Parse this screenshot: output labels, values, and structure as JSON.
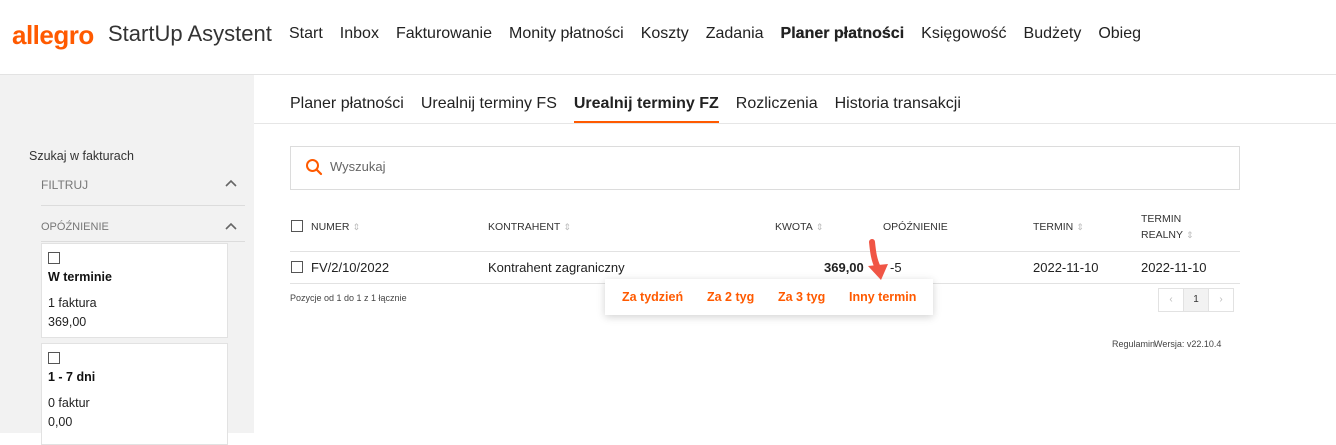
{
  "header": {
    "logo": "allegro",
    "app_name": "StartUp Asystent",
    "nav": [
      "Start",
      "Inbox",
      "Fakturowanie",
      "Monity płatności",
      "Koszty",
      "Zadania",
      "Planer płatności",
      "Księgowość",
      "Budżety",
      "Obieg"
    ],
    "active_nav": "Planer płatności"
  },
  "sidebar": {
    "title": "Szukaj w fakturach",
    "filter_section": "FILTRUJ",
    "delay_section": "OPÓŹNIENIE",
    "cards": [
      {
        "title": "W terminie",
        "count": "1 faktura",
        "amount": "369,00"
      },
      {
        "title": "1 - 7 dni",
        "count": "0 faktur",
        "amount": "0,00"
      }
    ]
  },
  "tabs": [
    "Planer płatności",
    "Urealnij terminy FS",
    "Urealnij terminy FZ",
    "Rozliczenia",
    "Historia transakcji"
  ],
  "active_tab": "Urealnij terminy FZ",
  "search": {
    "placeholder": "Wyszukaj"
  },
  "table": {
    "headers": {
      "numer": "NUMER",
      "kontrahent": "KONTRAHENT",
      "kwota": "KWOTA",
      "opoznienie": "OPÓŹNIENIE",
      "termin": "TERMIN",
      "termin_realny_1": "TERMIN",
      "termin_realny_2": "REALNY"
    },
    "rows": [
      {
        "numer": "FV/2/10/2022",
        "kontrahent": "Kontrahent zagraniczny",
        "kwota": "369,00",
        "opoznienie": "-5",
        "termin": "2022-11-10",
        "termin_realny": "2022-11-10"
      }
    ],
    "position_info": "Pozycje od 1 do 1 z 1 łącznie",
    "pager": {
      "prev": "‹",
      "current": "1",
      "next": "›"
    }
  },
  "popup": {
    "options": [
      "Za tydzień",
      "Za 2 tyg",
      "Za 3 tyg",
      "Inny termin"
    ]
  },
  "footer": {
    "terms": "Regulamin",
    "version": "Wersja: v22.10.4"
  },
  "colors": {
    "brand": "#ff5a00",
    "arrow": "#f05545"
  }
}
